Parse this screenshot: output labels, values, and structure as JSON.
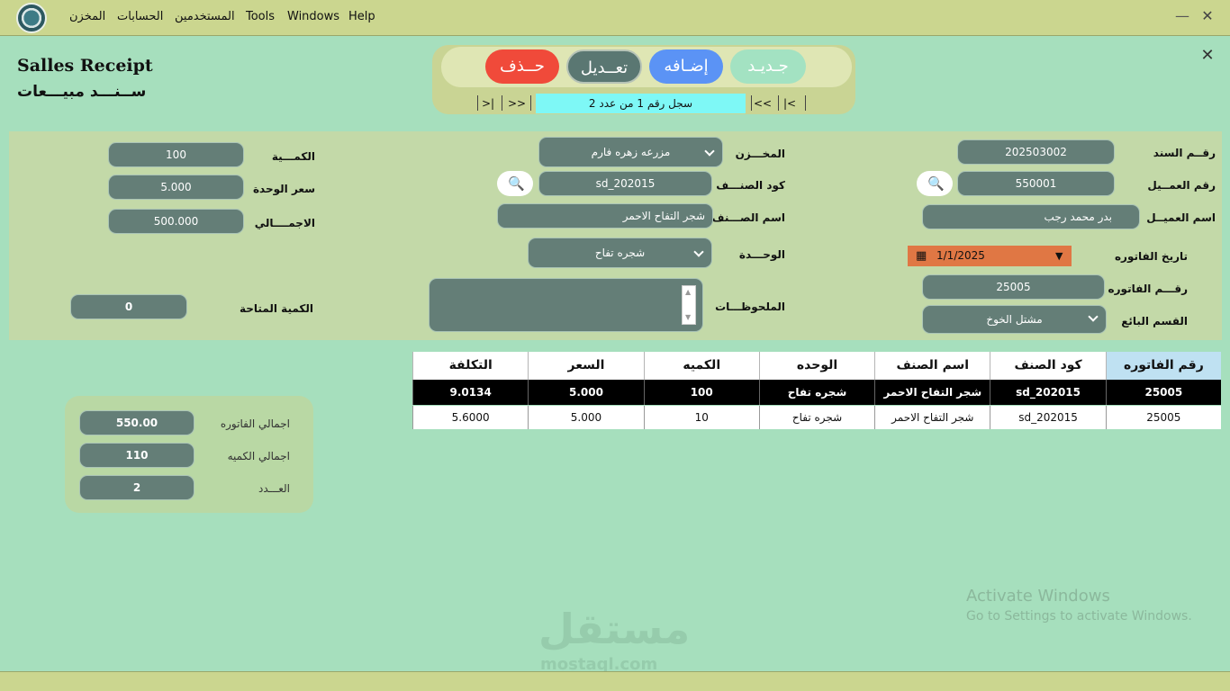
{
  "menu": {
    "items": [
      "المخزن",
      "الحسابات",
      "المستخدمين"
    ],
    "tools": "Tools",
    "windows": "Windows",
    "help": "Help"
  },
  "window_controls": {
    "minimize": "—",
    "close": "✕",
    "form_close": "✕"
  },
  "title": {
    "en": "Salles Receipt",
    "ar": "ســنـــد مبيـــعات"
  },
  "toolbar": {
    "delete": "حــذف",
    "edit": "تعــديل",
    "add": "إضـافه",
    "new": "جـديـد",
    "nav_first": "|<",
    "nav_prev": "<<",
    "nav_next": ">>",
    "nav_last": ">|",
    "record_info": "سجل رقم   1   من عدد   2"
  },
  "form": {
    "receipt_no_label": "رقــم السند",
    "receipt_no": "202503002",
    "customer_no_label": "رقم العمــيل",
    "customer_no": "550001",
    "customer_name_label": "اسم العميــل",
    "customer_name": "بدر محمد رجب",
    "invoice_date_label": "تاريخ الفاتوره",
    "invoice_date": "1/1/2025",
    "invoice_no_label": "رقـــم الفاتوره",
    "invoice_no": "25005",
    "sales_dept_label": "القسم البائع",
    "sales_dept": "مشتل الخوخ",
    "store_label": "المخـــزن",
    "store": "مزرعه زهره فارم",
    "item_code_label": "كود الصنـــف",
    "item_code": "sd_202015",
    "item_name_label": "اسم الصـــنف",
    "item_name": "شجر التفاح الاحمر",
    "unit_label": "الوحـــدة",
    "unit": "شجره تفاح",
    "notes_label": "الملحوظـــات",
    "quantity_label": "الكمـــية",
    "quantity": "100",
    "unit_price_label": "سعر الوحدة",
    "unit_price": "5.000",
    "total_label": "الاجمــــالي",
    "total": "500.000",
    "available_qty_label": "الكمية المتاحة",
    "available_qty": "0"
  },
  "grid": {
    "headers": [
      "رقم الفاتوره",
      "كود الصنف",
      "اسم الصنف",
      "الوحده",
      "الكميه",
      "السعر",
      "التكلفة"
    ],
    "rows": [
      [
        "25005",
        "sd_202015",
        "شجر التفاح الاحمر",
        "شجره تفاح",
        "100",
        "5.000",
        "9.0134"
      ],
      [
        "25005",
        "sd_202015",
        "شجر التفاح الاحمر",
        "شجره تفاح",
        "10",
        "5.000",
        "5.6000"
      ]
    ]
  },
  "totals": {
    "invoice_total_label": "اجمالي الفاتوره",
    "invoice_total": "550.00",
    "qty_total_label": "اجمالي الكميه",
    "qty_total": "110",
    "count_label": "العـــدد",
    "count": "2"
  },
  "watermark": {
    "activate": "Activate Windows",
    "activate_sub": "Go to Settings to activate Windows.",
    "brand": "مستقل",
    "brand_sub": "mostaql.com"
  },
  "colors": {
    "delete": "#f04a3a",
    "edit": "#5a7772",
    "add": "#5b93f5",
    "new": "#a3e2c2",
    "date": "#e07744",
    "record_info": "#7ef8f6"
  }
}
